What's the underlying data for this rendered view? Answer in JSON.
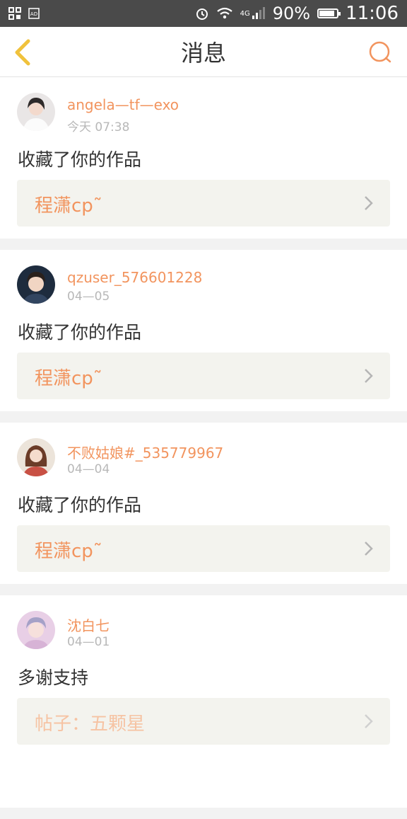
{
  "status_bar": {
    "battery_percent": "90%",
    "time": "11:06",
    "network_label": "4G",
    "battery_level": 0.9,
    "icons": [
      "grid-app-icon",
      "ad-icon",
      "alarm-icon",
      "wifi-icon",
      "signal-icon",
      "battery-icon"
    ]
  },
  "header": {
    "title": "消息",
    "accent_color": "#f2945e"
  },
  "messages": [
    {
      "username": "angela—tf—exo",
      "time": "今天  07:38",
      "action": "收藏了你的作品",
      "ref_title": "程潇cp˜"
    },
    {
      "username": "qzuser_576601228",
      "time": "04—05",
      "action": "收藏了你的作品",
      "ref_title": "程潇cp˜"
    },
    {
      "username": "不败姑娘#_535779967",
      "time": "04—04",
      "action": "收藏了你的作品",
      "ref_title": "程潇cp˜"
    },
    {
      "username": "沈白七",
      "time": "04—01",
      "action": "多谢支持",
      "ref_title": "帖子：五颗星"
    }
  ]
}
